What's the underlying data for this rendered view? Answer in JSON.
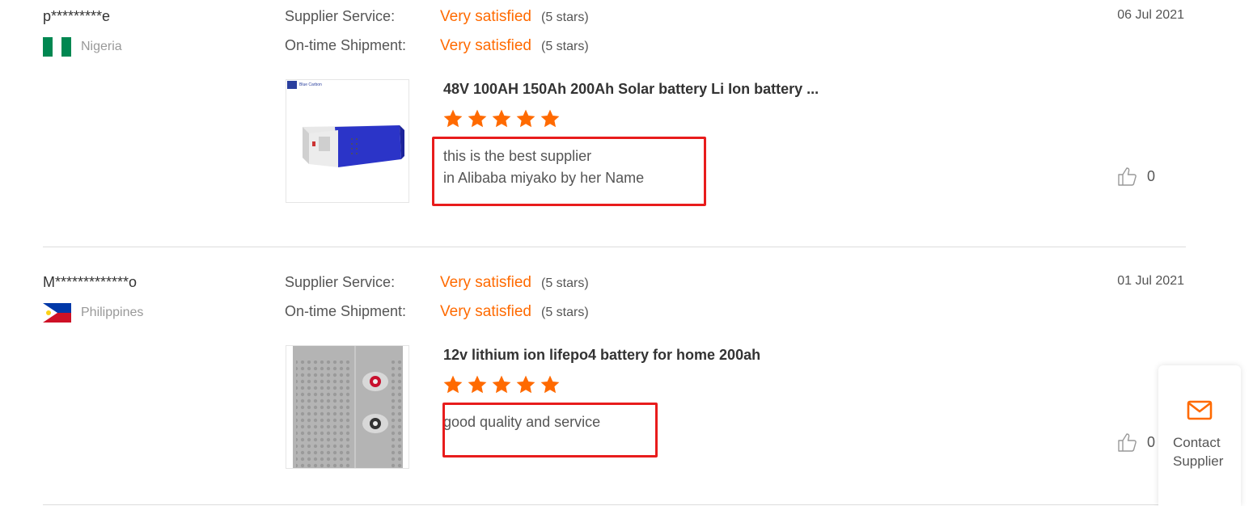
{
  "reviews": [
    {
      "buyer": "p*********e",
      "country": "Nigeria",
      "supplier_service_label": "Supplier Service:",
      "supplier_service_value": "Very satisfied",
      "supplier_service_stars": "(5 stars)",
      "shipment_label": "On-time Shipment:",
      "shipment_value": "Very satisfied",
      "shipment_stars": "(5 stars)",
      "date": "06 Jul 2021",
      "product_title": "48V 100AH 150Ah 200Ah Solar battery Li Ion battery ...",
      "product_rating": 5,
      "comment_line1": "this is the best supplier",
      "comment_line2": "in Alibaba miyako by her Name",
      "likes": "0",
      "brand_text": "Blue Carbon"
    },
    {
      "buyer": "M*************o",
      "country": "Philippines",
      "supplier_service_label": "Supplier Service:",
      "supplier_service_value": "Very satisfied",
      "supplier_service_stars": "(5 stars)",
      "shipment_label": "On-time Shipment:",
      "shipment_value": "Very satisfied",
      "shipment_stars": "(5 stars)",
      "date": "01 Jul 2021",
      "product_title": "12v lithium ion lifepo4 battery for home 200ah",
      "product_rating": 5,
      "comment_line1": "good quality and service",
      "likes": "0"
    }
  ],
  "contact": {
    "label": "Contact Supplier",
    "icon": "mail-icon"
  },
  "colors": {
    "accent": "#ff6a00",
    "highlight": "#e81c1c",
    "nigeria_green": "#008751"
  }
}
